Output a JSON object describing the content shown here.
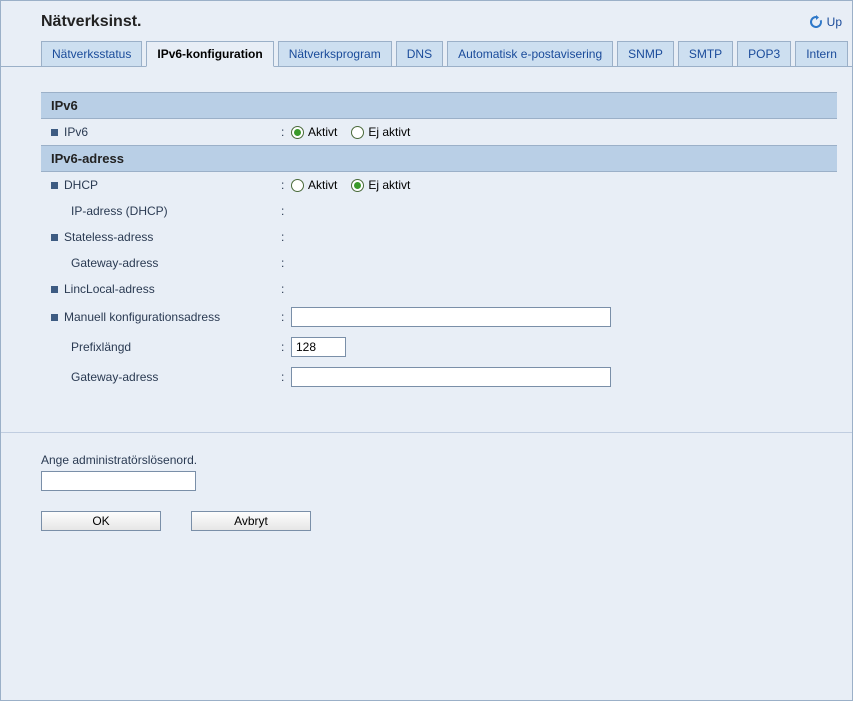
{
  "header": {
    "title": "Nätverksinst.",
    "refresh_label": "Up"
  },
  "tabs": [
    {
      "label": "Nätverksstatus",
      "active": false
    },
    {
      "label": "IPv6-konfiguration",
      "active": true
    },
    {
      "label": "Nätverksprogram",
      "active": false
    },
    {
      "label": "DNS",
      "active": false
    },
    {
      "label": "Automatisk e-postavisering",
      "active": false
    },
    {
      "label": "SNMP",
      "active": false
    },
    {
      "label": "SMTP",
      "active": false
    },
    {
      "label": "POP3",
      "active": false
    },
    {
      "label": "Intern",
      "active": false
    }
  ],
  "section_ipv6": {
    "title": "IPv6",
    "rows": {
      "ipv6_label": "IPv6",
      "radio_active": "Aktivt",
      "radio_inactive": "Ej aktivt",
      "ipv6_selected": "active"
    }
  },
  "section_addr": {
    "title": "IPv6-adress",
    "dhcp_label": "DHCP",
    "dhcp_radio_active": "Aktivt",
    "dhcp_radio_inactive": "Ej aktivt",
    "dhcp_selected": "inactive",
    "ip_dhcp_label": "IP-adress (DHCP)",
    "ip_dhcp_value": "",
    "stateless_label": "Stateless-adress",
    "stateless_value": "",
    "gateway1_label": "Gateway-adress",
    "gateway1_value": "",
    "linclocal_label": "LincLocal-adress",
    "linclocal_value": "",
    "manual_label": "Manuell konfigurationsadress",
    "manual_value": "",
    "prefix_label": "Prefixlängd",
    "prefix_value": "128",
    "gateway2_label": "Gateway-adress",
    "gateway2_value": ""
  },
  "footer": {
    "password_label": "Ange administratörslösenord.",
    "password_value": "",
    "ok_label": "OK",
    "cancel_label": "Avbryt"
  }
}
